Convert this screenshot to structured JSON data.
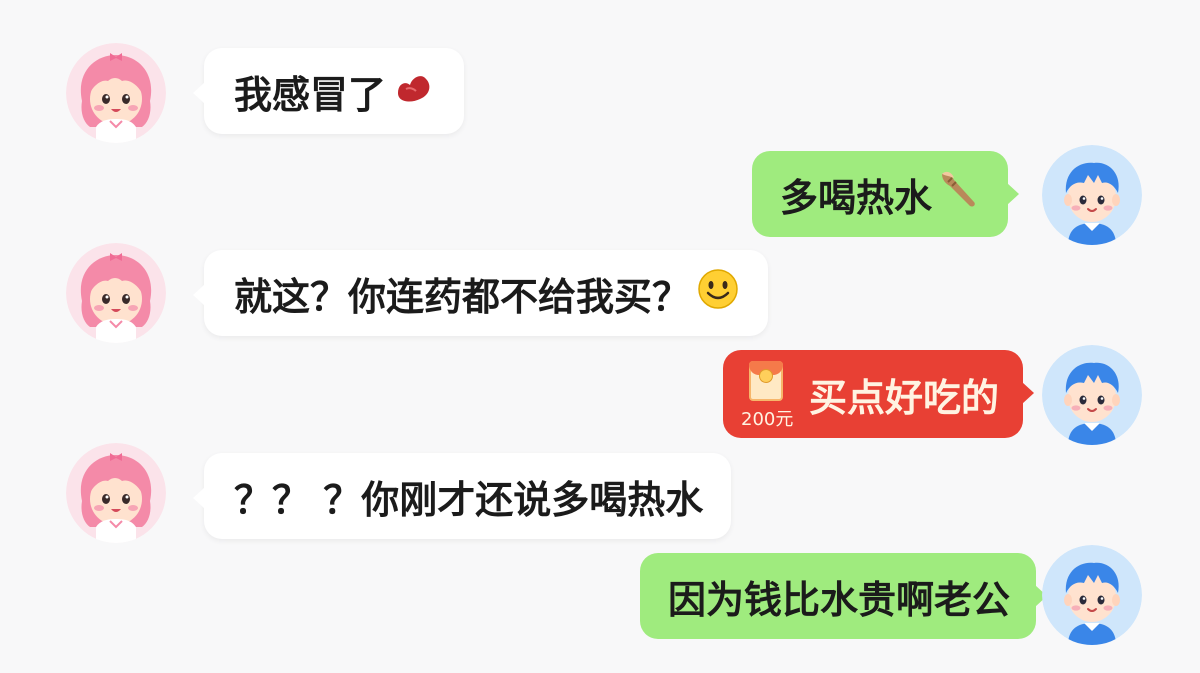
{
  "messages": [
    {
      "side": "left",
      "text": "我感冒了",
      "emoji": "red-bean-emoji"
    },
    {
      "side": "right",
      "text": "多喝热水",
      "emoji": "hand-waving-emoji"
    },
    {
      "side": "left",
      "text": "就这？你连药都不给我买？",
      "emoji": "smiley-emoji"
    },
    {
      "side": "right",
      "type": "red-packet",
      "text": "买点好吃的",
      "amount": "200元"
    },
    {
      "side": "left",
      "text": "？？ ？你刚才还说多喝热水"
    },
    {
      "side": "right",
      "text": "因为钱比水贵啊老公"
    }
  ],
  "avatars": {
    "left": {
      "name": "girl-avatar",
      "hair_color": "#f48aa8",
      "bg": "#fbe3ea"
    },
    "right": {
      "name": "boy-avatar",
      "hair_color": "#3a86e8",
      "bg": "#cfe6fb"
    }
  },
  "colors": {
    "background": "#f8f8f9",
    "left_bubble": "#ffffff",
    "right_bubble": "#9feb7e",
    "red_packet": "#e84034"
  }
}
